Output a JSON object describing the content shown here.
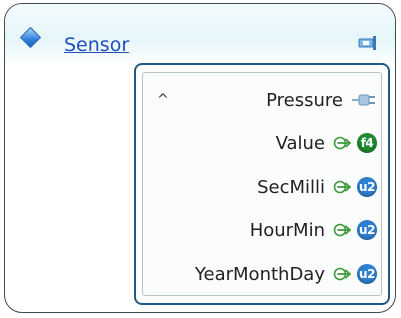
{
  "node": {
    "title": "Sensor",
    "header_icon": "diamond-icon",
    "connector_icon": "connector-icon",
    "group": {
      "collapse_icon": "^",
      "name": "Pressure",
      "name_icon": "plug-icon",
      "fields": [
        {
          "label": "Value",
          "type": "f4",
          "type_color": "#1f8a2e",
          "arrow_icon": "output-arrow-icon"
        },
        {
          "label": "SecMilli",
          "type": "u2",
          "type_color": "#2f7fd0",
          "arrow_icon": "output-arrow-icon"
        },
        {
          "label": "HourMin",
          "type": "u2",
          "type_color": "#2f7fd0",
          "arrow_icon": "output-arrow-icon"
        },
        {
          "label": "YearMonthDay",
          "type": "u2",
          "type_color": "#2f7fd0",
          "arrow_icon": "output-arrow-icon"
        }
      ]
    }
  }
}
